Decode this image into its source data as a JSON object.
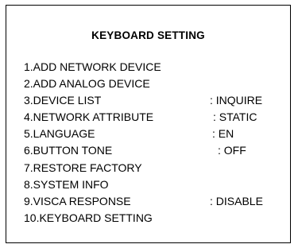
{
  "title": "KEYBOARD SETTING",
  "menu": {
    "items": [
      {
        "label": "1.ADD NETWORK DEVICE",
        "value": ""
      },
      {
        "label": "2.ADD ANALOG DEVICE",
        "value": ""
      },
      {
        "label": "3.DEVICE LIST",
        "value": ": INQUIRE"
      },
      {
        "label": "4.NETWORK ATTRIBUTE",
        "value": ": STATIC"
      },
      {
        "label": "5.LANGUAGE",
        "value": ": EN"
      },
      {
        "label": "6.BUTTON TONE",
        "value": ": OFF"
      },
      {
        "label": "7.RESTORE FACTORY",
        "value": ""
      },
      {
        "label": "8.SYSTEM INFO",
        "value": ""
      },
      {
        "label": "9.VISCA RESPONSE",
        "value": ": DISABLE"
      },
      {
        "label": "10.KEYBOARD SETTING",
        "value": ""
      }
    ]
  }
}
